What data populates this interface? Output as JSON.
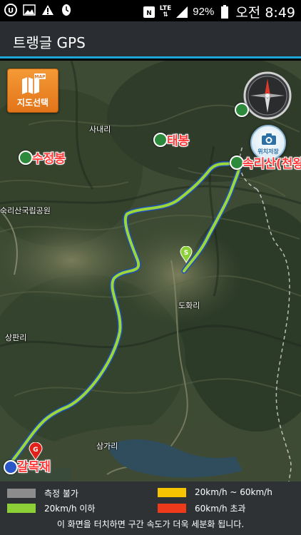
{
  "status_bar": {
    "battery": "92%",
    "network": "LTE",
    "time": "오전 8:49",
    "icons": [
      "u-plus-icon",
      "image-icon",
      "warning-icon",
      "clock-icon",
      "nfc-icon",
      "lte-icon",
      "signal-icon",
      "battery-icon"
    ]
  },
  "app": {
    "title": "트랭글 GPS"
  },
  "map": {
    "map_select_label": "지도선택",
    "map_select_badge": "MAP",
    "camera_label": "위치저장",
    "places": [
      {
        "name": "사내리"
      },
      {
        "name": "숙리산국립공원"
      },
      {
        "name": "도화리"
      },
      {
        "name": "상판리"
      },
      {
        "name": "삼가리"
      }
    ],
    "peaks": [
      {
        "name": "태봉"
      },
      {
        "name": "수정봉"
      },
      {
        "name": "속리산(천왕"
      },
      {
        "name": "갈목재"
      }
    ],
    "markers": {
      "start": "S",
      "goal": "G"
    },
    "colors": {
      "route": "#9dd63b",
      "route_outline": "#1d4fb8"
    }
  },
  "legend": {
    "items": [
      {
        "label": "측정 불가",
        "color": "#8c8c8c"
      },
      {
        "label": "20km/h ~ 60km/h",
        "color": "#f6c400"
      },
      {
        "label": "20km/h 이하",
        "color": "#8cd037"
      },
      {
        "label": "60km/h 초과",
        "color": "#ee3a1a"
      }
    ],
    "note": "이 화면을 터치하면 구간 속도가 더욱 세분화 됩니다."
  }
}
